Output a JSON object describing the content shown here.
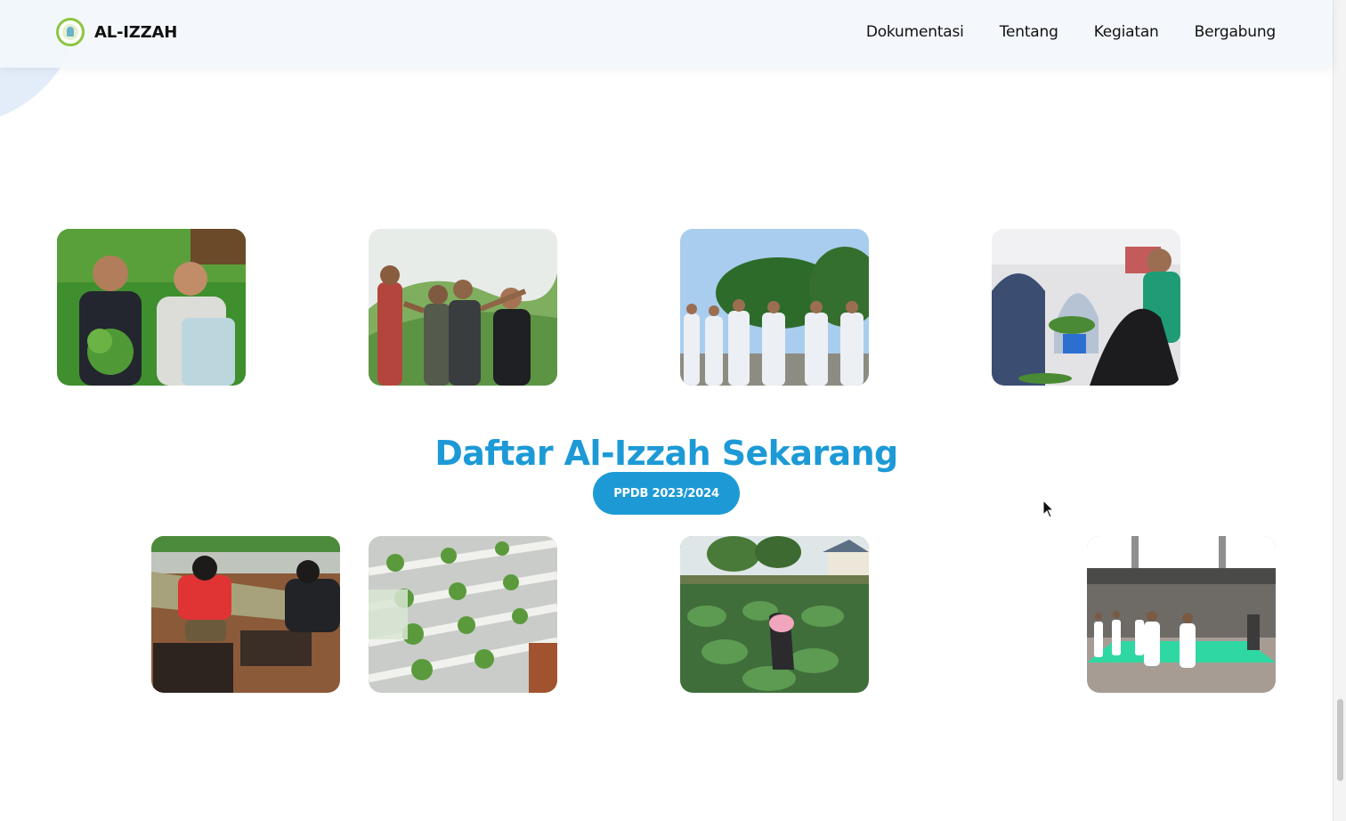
{
  "header": {
    "brand_name": "AL-IZZAH",
    "nav_items": [
      "Dokumentasi",
      "Tentang",
      "Kegiatan",
      "Bergabung"
    ]
  },
  "cta": {
    "title": "Daftar Al-Izzah Sekarang",
    "button_label": "PPDB 2023/2024"
  },
  "colors": {
    "accent": "#1d9ad6",
    "logo_ring": "#8cc63f",
    "header_bg": "#f3f7fc"
  },
  "gallery": {
    "top_row": [
      "photo-two-students-holding-plants",
      "photo-group-on-green-hills",
      "photo-scout-uniform-lineup",
      "photo-students-sorting-vegetables"
    ],
    "bottom_row": [
      "photo-planting-seedling-trays",
      "photo-hydroponic-racks",
      "photo-vegetable-field",
      "photo-martial-arts-practice"
    ]
  }
}
